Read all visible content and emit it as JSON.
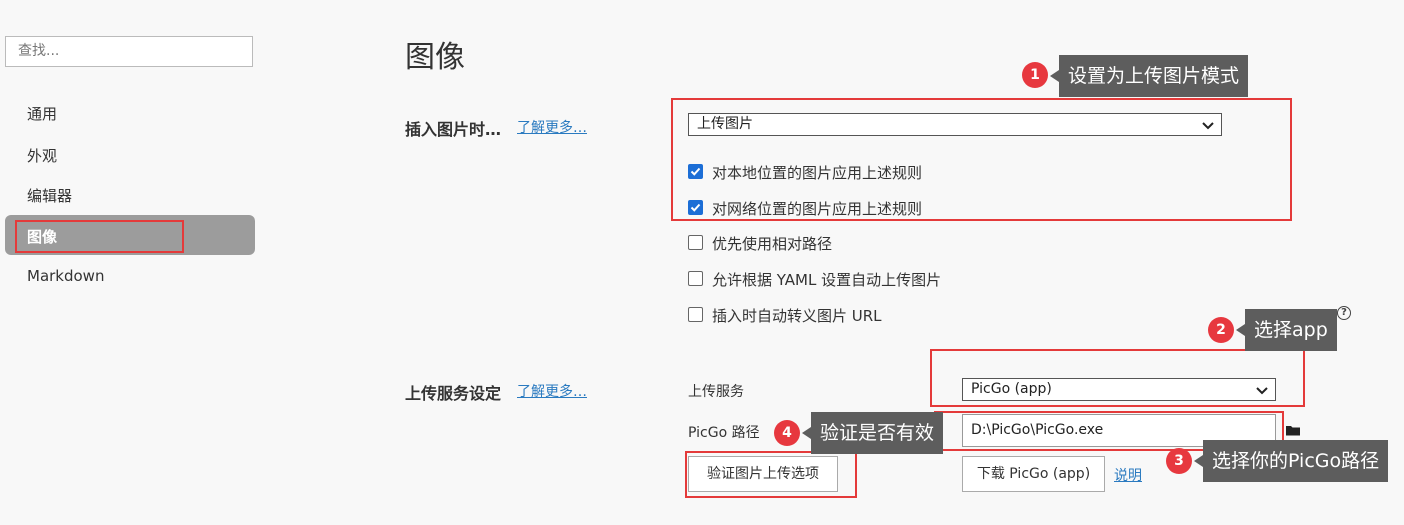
{
  "sidebar": {
    "search_placeholder": "查找...",
    "items": [
      {
        "label": "通用"
      },
      {
        "label": "外观"
      },
      {
        "label": "编辑器"
      },
      {
        "label": "图像",
        "active": true
      },
      {
        "label": "Markdown"
      }
    ]
  },
  "main": {
    "title": "图像",
    "insert_section": {
      "label": "插入图片时…",
      "learn_more": "了解更多…",
      "select_value": "上传图片",
      "checkboxes": [
        {
          "label": "对本地位置的图片应用上述规则",
          "checked": true
        },
        {
          "label": "对网络位置的图片应用上述规则",
          "checked": true
        },
        {
          "label": "优先使用相对路径",
          "checked": false
        },
        {
          "label": "允许根据 YAML 设置自动上传图片",
          "checked": false
        },
        {
          "label": "插入时自动转义图片 URL",
          "checked": false
        }
      ]
    },
    "upload_section": {
      "label": "上传服务设定",
      "learn_more": "了解更多…",
      "service_label": "上传服务",
      "service_value": "PicGo (app)",
      "path_label": "PicGo 路径",
      "path_value": "D:\\PicGo\\PicGo.exe",
      "verify_button": "验证图片上传选项",
      "download_button": "下载 PicGo (app)",
      "help_link": "说明"
    }
  },
  "annotations": [
    {
      "number": "1",
      "text": "设置为上传图片模式"
    },
    {
      "number": "2",
      "text": "选择app"
    },
    {
      "number": "3",
      "text": "选择你的PicGo路径"
    },
    {
      "number": "4",
      "text": "验证是否有效"
    }
  ],
  "colors": {
    "accent": "#1c6ed6",
    "annotation_red": "#e43a3a",
    "tooltip_bg": "#5d5d5d",
    "active_nav": "#9c9c9c",
    "link": "#2a7ac0"
  }
}
